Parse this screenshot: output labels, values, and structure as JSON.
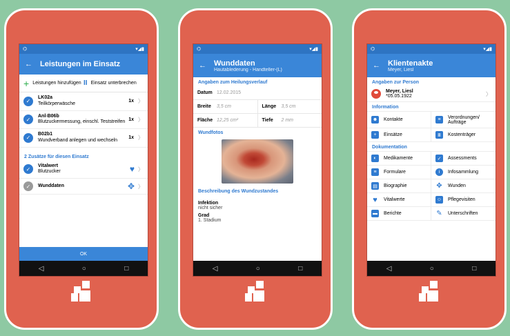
{
  "status": {
    "left": "⌬",
    "right": "▾◢▮"
  },
  "nav": {
    "back": "◁",
    "home": "○",
    "recent": "□"
  },
  "screen1": {
    "title": "Leistungen im Einsatz",
    "add_label": "Leistungen hinzufügen",
    "pause_label": "Einsatz unterbrechen",
    "items": [
      {
        "code": "LK02a",
        "desc": "Teilkörperwäsche",
        "count": "1x"
      },
      {
        "code": "Anl-B06b",
        "desc": "Blutzuckermessung, einschl. Teststreifen",
        "count": "1x"
      },
      {
        "code": "B02b1",
        "desc": "Wundverband anlegen und wechseln",
        "count": "1x"
      }
    ],
    "extra_header": "2 Zusätze für diesen Einsatz",
    "extras": [
      {
        "title": "Vitalwert",
        "sub": "Blutzucker"
      },
      {
        "title": "Wunddaten",
        "sub": ""
      }
    ],
    "ok": "OK"
  },
  "screen2": {
    "title": "Wunddaten",
    "subtitle": "Hautablederung - Handteller-(L)",
    "section_heal": "Angaben zum Heilungsverlauf",
    "datum_label": "Datum",
    "datum_value": "12.02.2015",
    "breite_label": "Breite",
    "breite_value": "3,5 cm",
    "laenge_label": "Länge",
    "laenge_value": "3,5 cm",
    "flaeche_label": "Fläche",
    "flaeche_value": "12,25 cm²",
    "tiefe_label": "Tiefe",
    "tiefe_value": "2 mm",
    "section_photos": "Wundfotos",
    "section_desc": "Beschreibung des Wundzustandes",
    "infektion_label": "Infektion",
    "infektion_value": "nicht sicher",
    "grad_label": "Grad",
    "grad_value": "1. Stadium"
  },
  "screen3": {
    "title": "Klientenakte",
    "subtitle": "Meyer, Liesl",
    "section_person": "Angaben zur Person",
    "person_name": "Meyer, Liesl",
    "person_birth": "*05.05.1922",
    "section_info": "Information",
    "info": [
      "Kontakte",
      "Verordnungen/ Aufträge",
      "Einsätze",
      "Kostenträger"
    ],
    "section_doc": "Dokumentation",
    "doc": [
      "Medikamente",
      "Assessments",
      "Formulare",
      "Infosammlung",
      "Biographie",
      "Wunden",
      "Vitalwerte",
      "Pflegevisiten",
      "Berichte",
      "Unterschriften"
    ]
  },
  "colors": {
    "background": "#8ec9a3",
    "phone": "#e0624f",
    "appbar": "#3a86d8",
    "accent": "#2f7ad0"
  }
}
